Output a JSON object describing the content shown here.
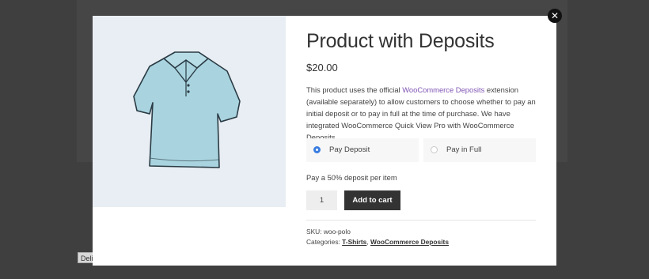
{
  "background": {
    "button_label": "Deli"
  },
  "modal": {
    "close_icon": "close-icon",
    "image_alt": "light blue polo shirt",
    "title": "Product with Deposits",
    "price": "$20.00",
    "description": {
      "before_link": "This product uses the official ",
      "link_text": "WooCommerce Deposits",
      "after_link": " extension (available separately) to allow customers to choose whether to pay an initial deposit or to pay in full at the time of purchase. We have integrated WooCommerce Quick View Pro with WooCommerce Deposits."
    },
    "payment_options": [
      {
        "label": "Pay Deposit",
        "selected": true
      },
      {
        "label": "Pay in Full",
        "selected": false
      }
    ],
    "deposit_note": "Pay a 50% deposit per item",
    "quantity": "1",
    "add_to_cart": "Add to cart",
    "sku_label": "SKU: ",
    "sku_value": "woo-polo",
    "categories_label": "Categories: ",
    "categories": [
      "T-Shirts",
      "WooCommerce Deposits"
    ],
    "categories_separator": ", "
  },
  "colors": {
    "link": "#7f54b3",
    "radio_selected": "#3a7de0",
    "button": "#333333"
  }
}
